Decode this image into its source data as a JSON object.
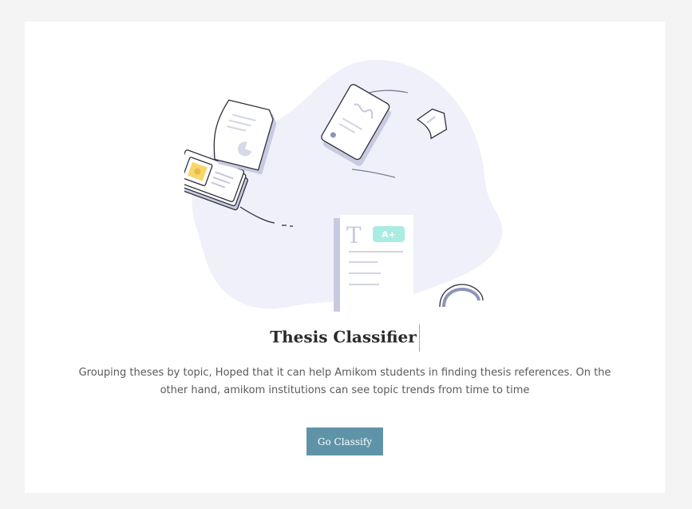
{
  "hero": {
    "title": "Thesis Classifier",
    "description": "Grouping theses by topic, Hoped that it can help Amikom students in finding thesis references. On the other hand, amikom institutions can see topic trends from time to time",
    "cta_label": "Go Classify",
    "illustration": {
      "doc_letter": "T",
      "grade_badge": "A+"
    }
  },
  "colors": {
    "page_bg": "#f4f4f4",
    "card_bg": "#ffffff",
    "blob": "#eff0f9",
    "button_bg": "#5f94a8",
    "badge": "#a8ece2",
    "accent_yellow": "#f7d66a"
  }
}
